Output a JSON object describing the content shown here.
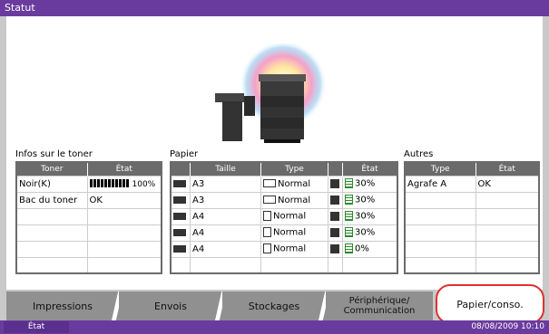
{
  "title": "Statut",
  "toner": {
    "section": "Infos sur le toner",
    "headers": [
      "Toner",
      "État"
    ],
    "rows": [
      {
        "name": "Noir(K)",
        "state": "",
        "pct": "100%",
        "level": 1.0
      },
      {
        "name": "Bac du toner",
        "state": "OK",
        "pct": "",
        "level": null
      }
    ]
  },
  "paper": {
    "section": "Papier",
    "headers": [
      "Taille",
      "Type",
      "État"
    ],
    "rows": [
      {
        "tray": "1",
        "size": "A3",
        "type": "Normal",
        "state": "30%",
        "orientation": "landscape"
      },
      {
        "tray": "2",
        "size": "A3",
        "type": "Normal",
        "state": "30%",
        "orientation": "landscape"
      },
      {
        "tray": "3",
        "size": "A4",
        "type": "Normal",
        "state": "30%",
        "orientation": "portrait"
      },
      {
        "tray": "4",
        "size": "A4",
        "type": "Normal",
        "state": "30%",
        "orientation": "portrait"
      },
      {
        "tray": "M",
        "size": "A4",
        "type": "Normal",
        "state": "0%",
        "orientation": "portrait"
      }
    ]
  },
  "others": {
    "section": "Autres",
    "headers": [
      "Type",
      "État"
    ],
    "rows": [
      {
        "type": "Agrafe A",
        "state": "OK"
      }
    ]
  },
  "tabs": [
    {
      "label": "Impressions"
    },
    {
      "label": "Envois"
    },
    {
      "label": "Stockages"
    },
    {
      "label": "Périphérique/\nCommunication"
    },
    {
      "label": "Papier/conso.",
      "active": true
    }
  ],
  "status_bar": {
    "button": "État",
    "datetime": "08/08/2009   10:10"
  },
  "colors": {
    "title": "#6a3b9e",
    "tab": "#909090",
    "highlight": "#e0312e"
  }
}
